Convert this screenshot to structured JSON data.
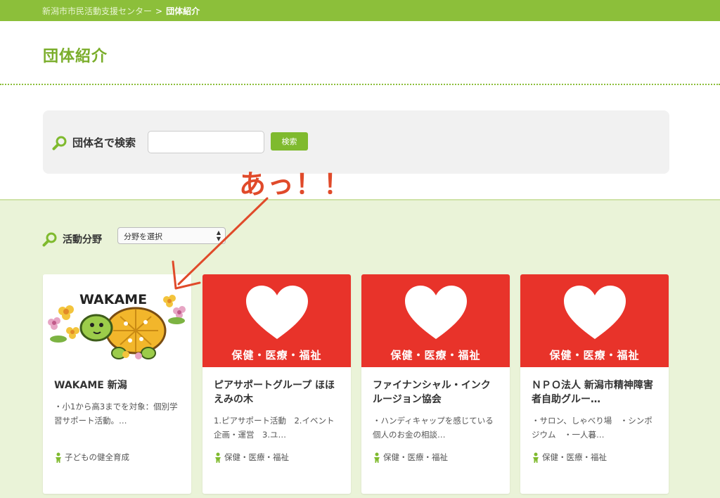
{
  "breadcrumb": {
    "home": "新潟市市民活動支援センター",
    "separator": ">",
    "current": "団体紹介"
  },
  "page_title": "団体紹介",
  "search": {
    "label": "団体名で検索",
    "value": "",
    "placeholder": "",
    "button": "検索"
  },
  "annotation": "あっ！！",
  "category_filter": {
    "label": "活動分野",
    "selected": "分野を選択"
  },
  "colors": {
    "brand_green": "#8cbf3a",
    "accent_red": "#e8332a",
    "annotation_red": "#e04a2a",
    "section_bg": "#eaf3d8"
  },
  "cards": [
    {
      "image_type": "logo",
      "logo_text": "WAKAME",
      "title": "WAKAME 新潟",
      "desc": "・小1から高3までを対象：個別学習サポート活動。…",
      "category": "子どもの健全育成",
      "icon": "person-icon"
    },
    {
      "image_type": "heart",
      "image_label": "保健・医療・福祉",
      "title": "ピアサポートグループ ほほえみの木",
      "desc": "1.ピアサポート活動　2.イベント企画・運営　3.ユ…",
      "category": "保健・医療・福祉",
      "icon": "person-icon"
    },
    {
      "image_type": "heart",
      "image_label": "保健・医療・福祉",
      "title": "ファイナンシャル・インクルージョン協会",
      "desc": "・ハンディキャップを感じている個人のお金の相談…",
      "category": "保健・医療・福祉",
      "icon": "person-icon"
    },
    {
      "image_type": "heart",
      "image_label": "保健・医療・福祉",
      "title": "ＮＰＯ法人 新潟市精神障害者自助グルー…",
      "desc": "・サロン、しゃべり場　・シンポジウム　・一人暮…",
      "category": "保健・医療・福祉",
      "icon": "person-icon"
    }
  ]
}
